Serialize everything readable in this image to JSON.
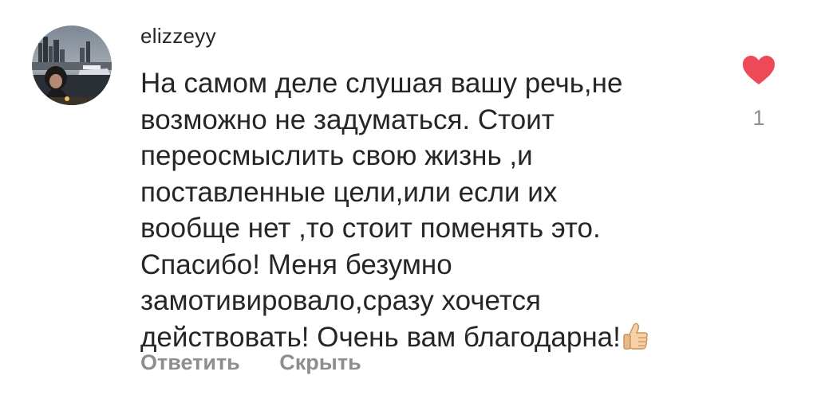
{
  "comment": {
    "username": "elizzeyy",
    "text": "На самом деле слушая вашу речь,не\nвозможно не задуматься. Стоит\nпереосмыслить свою жизнь ,и\nпоставленные цели,или если их\nвообще нет ,то стоит поменять это.\nСпасибо! Меня безумно\nзамотивировало,сразу хочется\nдействовать! Очень вам благодарна!",
    "emoji": "thumbs-up-icon",
    "like_count": "1",
    "like_icon": "heart-icon",
    "like_color": "#ed4956",
    "actions": {
      "reply_label": "Ответить",
      "hide_label": "Скрыть"
    }
  },
  "colors": {
    "text": "#262626",
    "muted": "#8e8e8e",
    "background": "#ffffff"
  }
}
